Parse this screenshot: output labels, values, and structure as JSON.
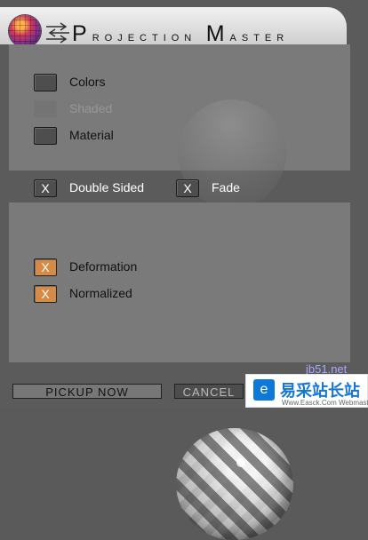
{
  "window": {
    "title_initial_1": "P",
    "title_rest_1": "rojection",
    "title_initial_2": "M",
    "title_rest_2": "aster"
  },
  "options": {
    "colors": "Colors",
    "shaded": "Shaded",
    "material": "Material",
    "double_sided": "Double Sided",
    "double_sided_mark": "X",
    "fade": "Fade",
    "fade_mark": "X",
    "deformation": "Deformation",
    "deformation_mark": "X",
    "normalized": "Normalized",
    "normalized_mark": "X"
  },
  "buttons": {
    "pickup": "PICKUP NOW",
    "cancel": "CANCEL"
  },
  "watermark": {
    "site": "jb51.net",
    "brand": "易采站长站",
    "subtitle": "Www.Easck.Com Webmaster"
  },
  "colors": {
    "window_bg": "#5b5b5b",
    "panel_bg": "#7a7a7a",
    "orange_check": "#d58a45",
    "watermark_blue": "#1675d8"
  },
  "icons": {
    "logo": "projection-master-logo-icon",
    "arrows": "arrows-icon",
    "badge": "site-logo-icon"
  }
}
